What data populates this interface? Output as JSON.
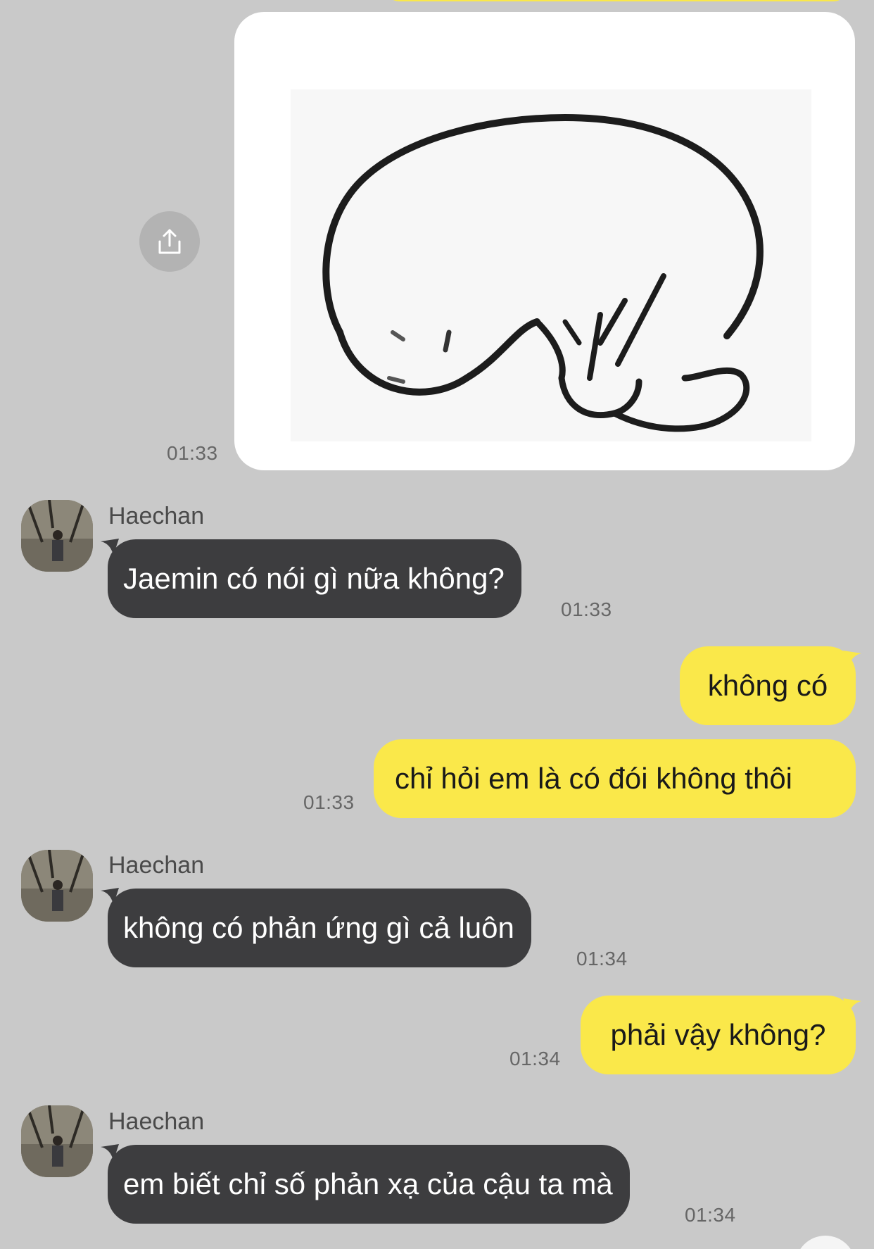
{
  "image_message": {
    "time": "01:33",
    "share_icon": "share-upload-icon",
    "image_description_icon": "sleeping-cat-doodle"
  },
  "messages": [
    {
      "sender": "Haechan",
      "text": "Jaemin có nói gì nữa không?",
      "time": "01:33",
      "direction": "incoming"
    },
    {
      "text": "không có",
      "direction": "outgoing"
    },
    {
      "text": "chỉ hỏi em là có đói không thôi",
      "time": "01:33",
      "direction": "outgoing"
    },
    {
      "sender": "Haechan",
      "text": "không có phản ứng gì cả luôn",
      "time": "01:34",
      "direction": "incoming"
    },
    {
      "text": "phải vậy không?",
      "time": "01:34",
      "direction": "outgoing"
    },
    {
      "sender": "Haechan",
      "text": "em biết chỉ số phản xạ của cậu ta mà",
      "time": "01:34",
      "direction": "incoming"
    }
  ],
  "colors": {
    "background": "#c9c9c9",
    "incoming_bubble": "#3d3d3f",
    "outgoing_bubble": "#fae84a",
    "timestamp": "#666666"
  }
}
